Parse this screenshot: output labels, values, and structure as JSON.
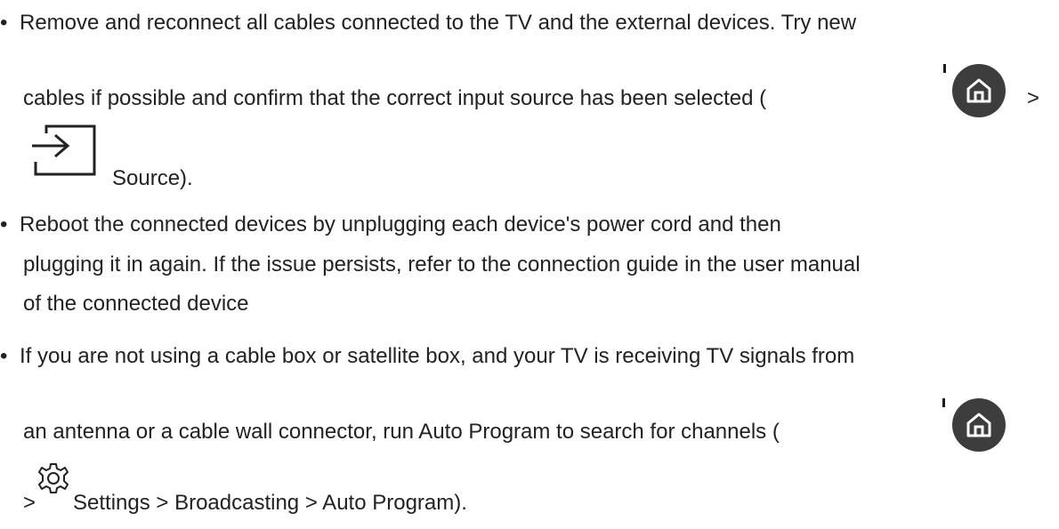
{
  "bullets": [
    {
      "line1": "Remove and reconnect all cables connected to the TV and the external devices. Try new",
      "line2": "cables if possible and confirm that the correct input source has been selected (",
      "after_home": ">",
      "line3": "Source)."
    },
    {
      "line1": "Reboot the connected devices by unplugging each device's power cord and then",
      "line2": "plugging it in again. If the issue persists, refer to the connection guide in the user manual",
      "line3": "of the connected device"
    },
    {
      "line1": "If you are not using a cable box or satellite box, and your TV is receiving TV signals from",
      "line2": "an antenna or a cable wall connector, run Auto Program to search for channels (",
      "before_gear": ">",
      "line3": "Settings > Broadcasting > Auto Program)."
    }
  ],
  "bullet_char": "•",
  "icons": {
    "home": "home-icon",
    "source": "source-input-icon",
    "settings": "gear-icon"
  },
  "colors": {
    "text": "#222222",
    "icon_circle": "#3d3d3d",
    "icon_glyph": "#ffffff"
  }
}
